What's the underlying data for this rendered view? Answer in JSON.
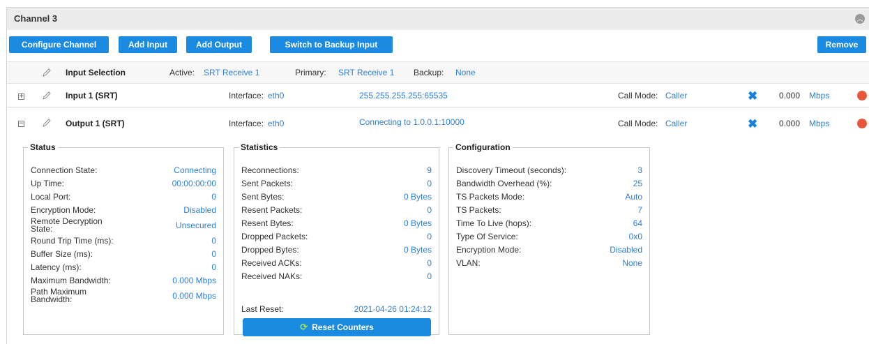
{
  "channel": {
    "title": "Channel 3"
  },
  "toolbar": {
    "configure_label": "Configure Channel",
    "add_input_label": "Add Input",
    "add_output_label": "Add Output",
    "switch_backup_label": "Switch to Backup Input",
    "remove_label": "Remove"
  },
  "input_selection": {
    "title": "Input Selection",
    "active_label": "Active:",
    "active_value": "SRT Receive 1",
    "primary_label": "Primary:",
    "primary_value": "SRT Receive 1",
    "backup_label": "Backup:",
    "backup_value": "None"
  },
  "input1": {
    "expander": "+",
    "title": "Input 1 (SRT)",
    "interface_label": "Interface:",
    "interface_value": "eth0",
    "address": "255.255.255.255:65535",
    "call_mode_label": "Call Mode:",
    "call_mode_value": "Caller",
    "rate": "0.000",
    "rate_unit": "Mbps",
    "status_color": "#e8563a"
  },
  "output1": {
    "expander": "−",
    "title": "Output 1 (SRT)",
    "interface_label": "Interface:",
    "interface_value": "eth0",
    "address": "Connecting to 1.0.0.1:10000",
    "call_mode_label": "Call Mode:",
    "call_mode_value": "Caller",
    "rate": "0.000",
    "rate_unit": "Mbps",
    "status_color": "#e8563a"
  },
  "status_panel": {
    "legend": "Status",
    "items": [
      {
        "k": "Connection State:",
        "v": "Connecting"
      },
      {
        "k": "Up Time:",
        "v": "00:00:00:00"
      },
      {
        "k": "Local Port:",
        "v": "0"
      },
      {
        "k": "Encryption Mode:",
        "v": "Disabled"
      },
      {
        "k": "Remote Decryption\nState:",
        "v": "Unsecured"
      },
      {
        "k": "Round Trip Time (ms):",
        "v": "0"
      },
      {
        "k": "Buffer Size (ms):",
        "v": "0"
      },
      {
        "k": "Latency (ms):",
        "v": "0"
      },
      {
        "k": "Maximum Bandwidth:",
        "v": "0.000 Mbps"
      },
      {
        "k": "Path Maximum\nBandwidth:",
        "v": "0.000 Mbps"
      }
    ]
  },
  "statistics_panel": {
    "legend": "Statistics",
    "items": [
      {
        "k": "Reconnections:",
        "v": "9"
      },
      {
        "k": "Sent Packets:",
        "v": "0"
      },
      {
        "k": "Sent Bytes:",
        "v": "0 Bytes"
      },
      {
        "k": "Resent Packets:",
        "v": "0"
      },
      {
        "k": "Resent Bytes:",
        "v": "0 Bytes"
      },
      {
        "k": "Dropped Packets:",
        "v": "0"
      },
      {
        "k": "Dropped Bytes:",
        "v": "0 Bytes"
      },
      {
        "k": "Received ACKs:",
        "v": "0"
      },
      {
        "k": "Received NAKs:",
        "v": "0"
      }
    ],
    "last_reset_label": "Last Reset:",
    "last_reset_value": "2021-04-26 01:24:12",
    "reset_button_label": "Reset Counters"
  },
  "configuration_panel": {
    "legend": "Configuration",
    "items": [
      {
        "k": "Discovery Timeout (seconds):",
        "v": "3"
      },
      {
        "k": "Bandwidth Overhead (%):",
        "v": "25"
      },
      {
        "k": "TS Packets Mode:",
        "v": "Auto"
      },
      {
        "k": "TS Packets:",
        "v": "7"
      },
      {
        "k": "Time To Live (hops):",
        "v": "64"
      },
      {
        "k": "Type Of Service:",
        "v": "0x0"
      },
      {
        "k": "Encryption Mode:",
        "v": "Disabled"
      },
      {
        "k": "VLAN:",
        "v": "None"
      }
    ]
  }
}
